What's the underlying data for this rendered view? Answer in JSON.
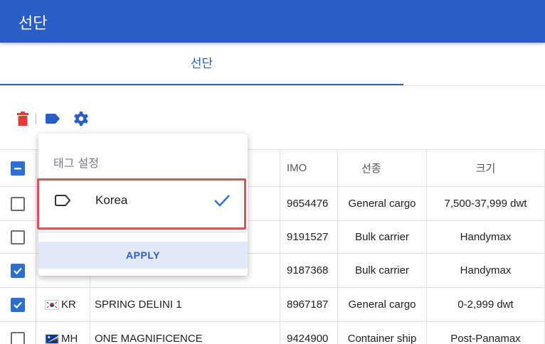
{
  "appbar": {
    "title": "선단"
  },
  "tabs": [
    {
      "label": "선단"
    }
  ],
  "toolbar": {
    "icons": [
      "delete-icon",
      "tag-icon",
      "settings-icon"
    ],
    "colors": {
      "delete": "#e53935",
      "tag": "#2b5dc7",
      "settings": "#2b5dc7"
    }
  },
  "table": {
    "headers": {
      "imo": "IMO",
      "type": "선종",
      "size": "크기"
    },
    "rows": [
      {
        "checked": false,
        "country": "",
        "name": "",
        "imo": "9654476",
        "type": "General cargo",
        "size": "7,500-37,999 dwt"
      },
      {
        "checked": false,
        "country": "",
        "name": "",
        "imo": "9191527",
        "type": "Bulk carrier",
        "size": "Handymax"
      },
      {
        "checked": true,
        "country": "",
        "name": "",
        "imo": "9187368",
        "type": "Bulk carrier",
        "size": "Handymax"
      },
      {
        "checked": true,
        "country": "KR",
        "name": "SPRING DELINI 1",
        "imo": "8967187",
        "type": "General cargo",
        "size": "0-2,999 dwt"
      },
      {
        "checked": false,
        "country": "MH",
        "name": "ONE MAGNIFICENCE",
        "imo": "9424900",
        "type": "Container ship",
        "size": "Post-Panamax"
      }
    ]
  },
  "tag_menu": {
    "title": "태그 설정",
    "items": [
      {
        "label": "Korea",
        "selected": true
      }
    ],
    "apply_label": "APPLY"
  },
  "colors": {
    "primary": "#2b5dc7",
    "checkbox": "#2b6fd6",
    "highlight": "#e05252"
  }
}
